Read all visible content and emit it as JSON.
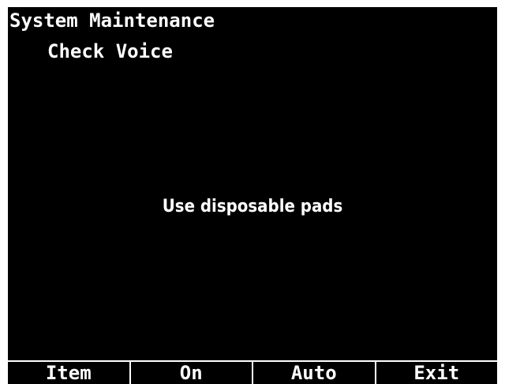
{
  "header": {
    "title": "System Maintenance",
    "subtitle": "Check Voice"
  },
  "main": {
    "message": "Use disposable pads"
  },
  "softkeys": [
    {
      "label": "Item"
    },
    {
      "label": "On"
    },
    {
      "label": "Auto"
    },
    {
      "label": "Exit"
    }
  ],
  "colors": {
    "background": "#000000",
    "text": "#ffffff",
    "frame": "#ffffff"
  }
}
